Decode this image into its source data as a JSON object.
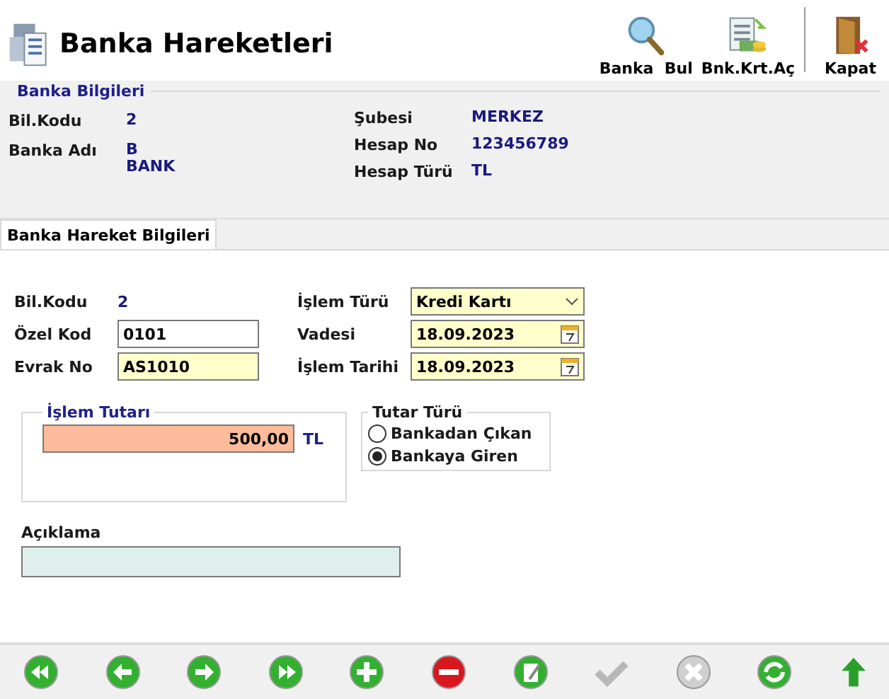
{
  "window": {
    "title": "Banka Hareketleri"
  },
  "toolbar": [
    {
      "kind": "search",
      "label": "Banka  Bul"
    },
    {
      "kind": "card",
      "label": "Bnk.Krt.Aç"
    },
    {
      "kind": "close",
      "label": "Kapat"
    }
  ],
  "bank_info": {
    "title": "Banka Bilgileri",
    "left": [
      {
        "label": "Bil.Kodu",
        "value": "2"
      },
      {
        "label": "Banka Adı",
        "value": "B\nBANK"
      }
    ],
    "right": [
      {
        "label": "Şubesi",
        "value": "MERKEZ"
      },
      {
        "label": "Hesap No",
        "value": "123456789"
      },
      {
        "label": "Hesap Türü",
        "value": "TL"
      }
    ]
  },
  "tabs": [
    {
      "label": "Banka Hareket Bilgileri",
      "selected": true
    }
  ],
  "form": {
    "bil_kodu": {
      "label": "Bil.Kodu",
      "value": "2"
    },
    "ozel_kod": {
      "label": "Özel Kod",
      "value": "0101"
    },
    "evrak_no": {
      "label": "Evrak No",
      "value": "AS1010"
    },
    "islem_turu": {
      "label": "İşlem Türü",
      "value": "Kredi Kartı"
    },
    "vadesi": {
      "label": "Vadesi",
      "value": "18.09.2023"
    },
    "islem_tarihi": {
      "label": "İşlem Tarihi",
      "value": "18.09.2023"
    },
    "amount_group": {
      "title": "İşlem Tutarı",
      "value": "500,00",
      "currency": "TL"
    },
    "tutar_turu": {
      "title": "Tutar Türü",
      "options": [
        {
          "label": "Bankadan Çıkan",
          "selected": false
        },
        {
          "label": "Bankaya Giren",
          "selected": true
        }
      ]
    },
    "aciklama": {
      "label": "Açıklama"
    }
  },
  "nav_buttons": [
    {
      "kind": "first",
      "disabled": false
    },
    {
      "kind": "prev",
      "disabled": false
    },
    {
      "kind": "next",
      "disabled": false
    },
    {
      "kind": "last",
      "disabled": false
    },
    {
      "kind": "add",
      "disabled": false
    },
    {
      "kind": "delete",
      "disabled": false
    },
    {
      "kind": "edit",
      "disabled": false
    },
    {
      "kind": "save",
      "disabled": true
    },
    {
      "kind": "cancel",
      "disabled": true
    },
    {
      "kind": "refresh",
      "disabled": false
    },
    {
      "kind": "up",
      "disabled": false
    }
  ]
}
